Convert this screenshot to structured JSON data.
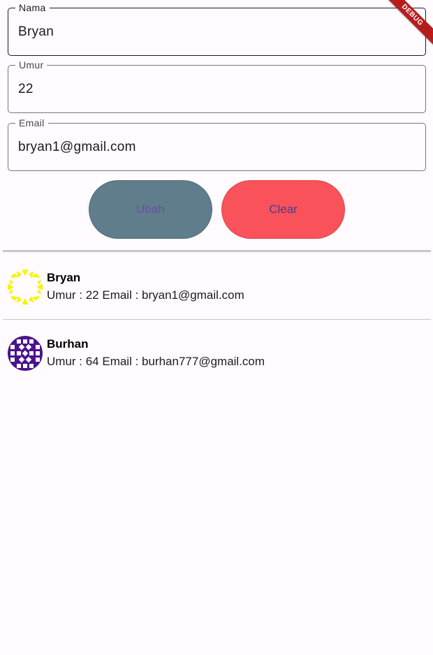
{
  "form": {
    "nama": {
      "label": "Nama",
      "value": "Bryan"
    },
    "umur": {
      "label": "Umur",
      "value": "22"
    },
    "email": {
      "label": "Email",
      "value": "bryan1@gmail.com"
    }
  },
  "buttons": {
    "ubah": {
      "label": "Ubah",
      "bg": "#607d8b",
      "fg": "#6750a4"
    },
    "clear": {
      "label": "Clear",
      "bg": "#f9525a",
      "fg": "#4b3e85"
    }
  },
  "list": [
    {
      "name": "Bryan",
      "subtitle": "Umur : 22 Email : bryan1@gmail.com",
      "avatar_icon": "yellow-star-pattern-icon",
      "avatar_color": "#f5f50a"
    },
    {
      "name": "Burhan",
      "subtitle": "Umur : 64 Email : burhan777@gmail.com",
      "avatar_icon": "purple-grid-pattern-icon",
      "avatar_color": "#4a148c"
    }
  ],
  "debug_banner": {
    "label": "DEBUG",
    "color": "#b71c1c"
  },
  "theme": {
    "background": "#fffbfe",
    "outline": "#79747e",
    "divider": "#cac4d0"
  }
}
